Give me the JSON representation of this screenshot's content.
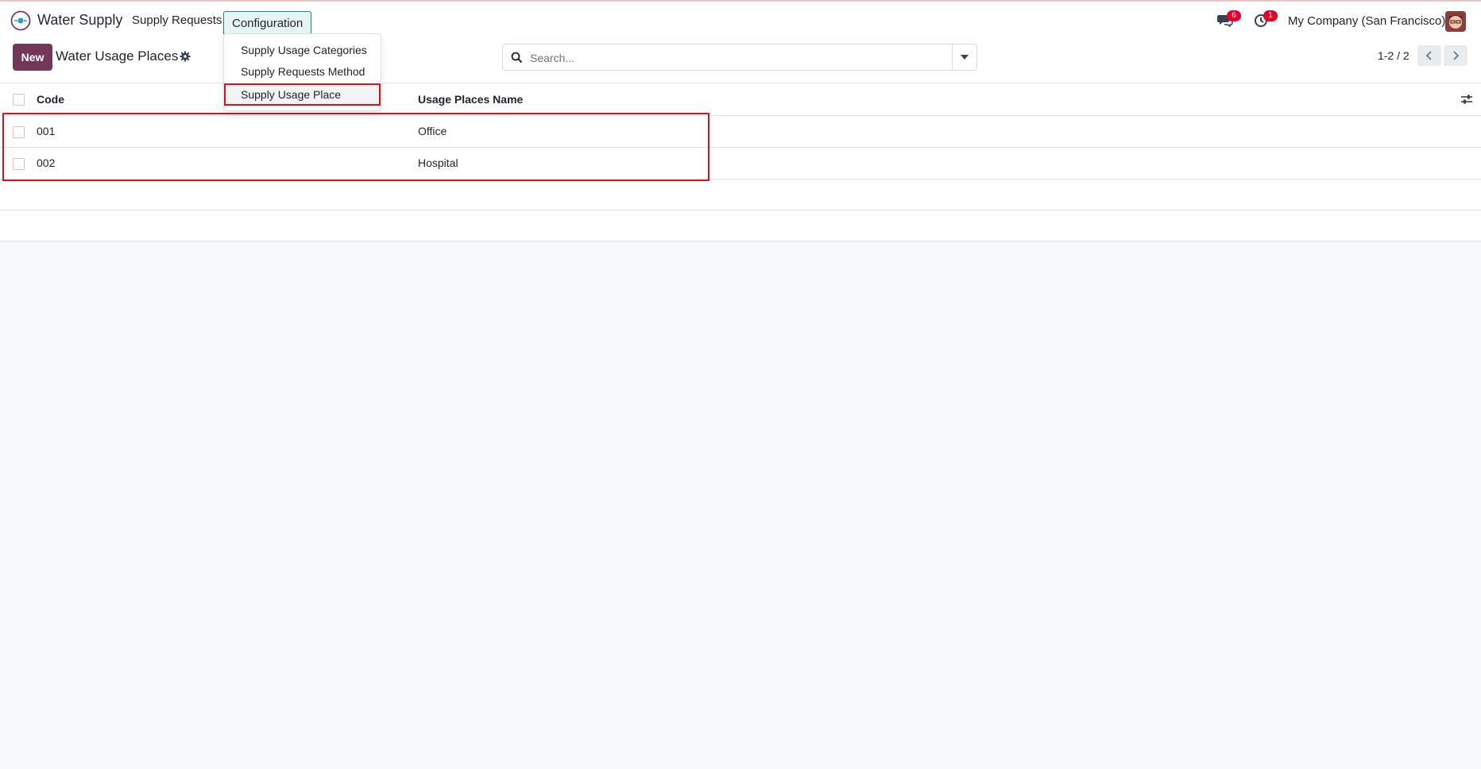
{
  "navbar": {
    "brand": "Water Supply",
    "menu": [
      "Supply Requests",
      "Configuration"
    ],
    "messages_badge": "6",
    "activity_badge": "1",
    "company": "My Company (San Francisco)",
    "icons": [
      "app-logo-icon",
      "chat-icon",
      "clock-icon",
      "user-avatar"
    ]
  },
  "config_menu": {
    "items": [
      "Supply Usage Categories",
      "Supply Requests Method",
      "Supply Usage Place"
    ],
    "selected": "Supply Usage Place"
  },
  "control_panel": {
    "new_label": "New",
    "title": "Water Usage Places",
    "search_placeholder": "Search...",
    "pager": "1-2 / 2"
  },
  "table": {
    "columns": [
      "Code",
      "Usage Places Name"
    ],
    "rows": [
      {
        "code": "001",
        "name": "Office"
      },
      {
        "code": "002",
        "name": "Hospital"
      }
    ]
  },
  "colors": {
    "primary": "#71385c",
    "active_menu_border": "#0f8a8a",
    "highlight": "#e0101c",
    "badge": "#e3002b"
  }
}
